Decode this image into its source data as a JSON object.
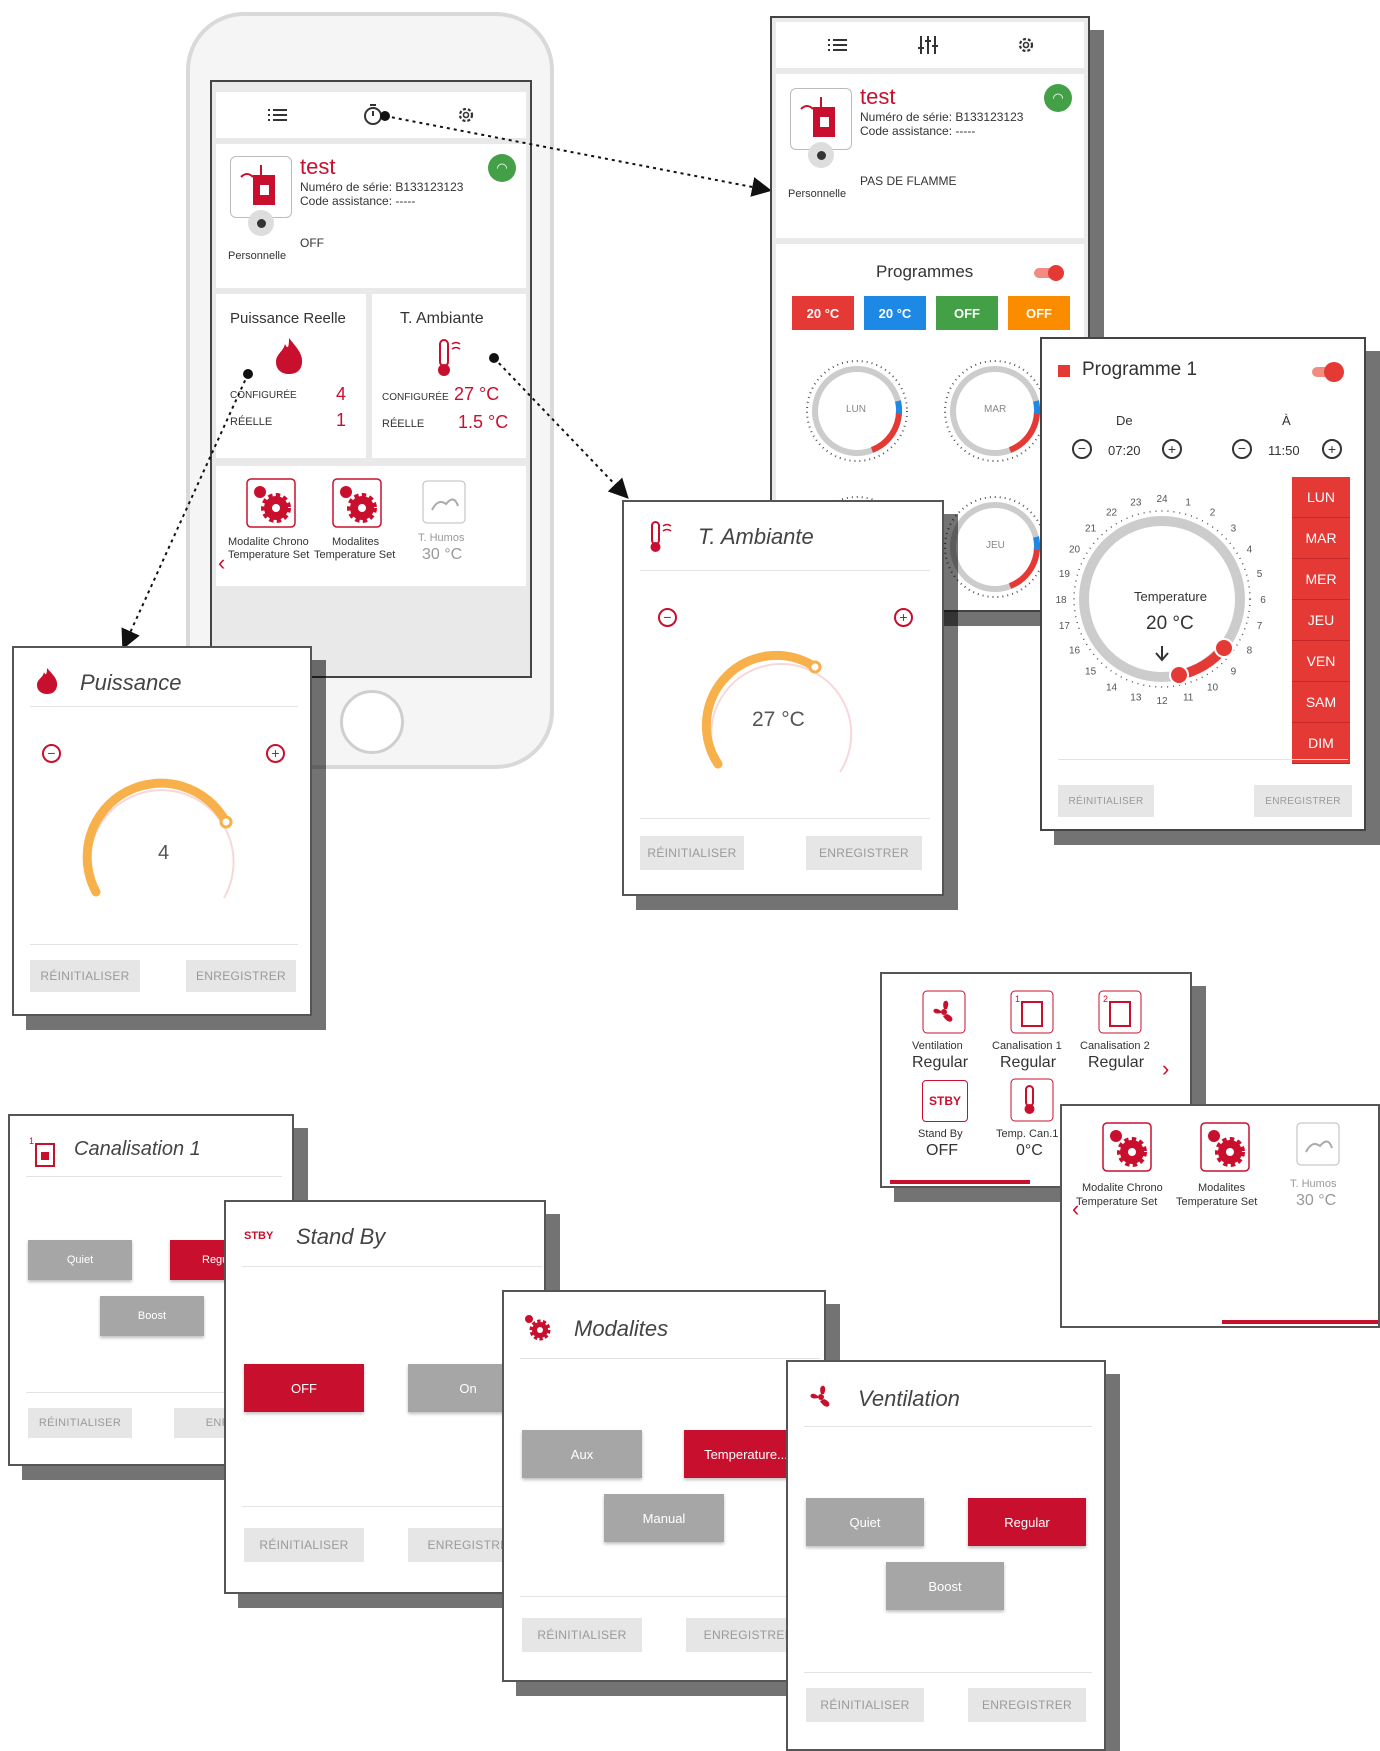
{
  "device": {
    "name": "test",
    "serial": "Numéro de série: B133123123",
    "assist": "Code assistance: -----",
    "user": "Personnelle",
    "state_off": "OFF",
    "state_flame": "PAS DE FLAMME"
  },
  "tiles": {
    "puissance": {
      "title": "Puissance Reelle",
      "conf_label": "CONFIGURÉE",
      "conf_val": "4",
      "reel_label": "RÉELLE",
      "reel_val": "1"
    },
    "ambiante": {
      "title": "T. Ambiante",
      "conf_label": "CONFIGURÉE",
      "conf_val": "27 °C",
      "reel_label": "RÉELLE",
      "reel_val": "1.5 °C"
    },
    "modalite_chrono": {
      "l1": "Modalite Chrono",
      "l2": "Temperature Set"
    },
    "modalites": {
      "l1": "Modalites",
      "l2": "Temperature Set"
    },
    "humos": {
      "l1": "T. Humos",
      "val": "30 °C"
    }
  },
  "programmes": {
    "title": "Programmes",
    "pills": [
      {
        "label": "20 °C",
        "color": "#e53935"
      },
      {
        "label": "20 °C",
        "color": "#1e88e5"
      },
      {
        "label": "OFF",
        "color": "#43a047"
      },
      {
        "label": "OFF",
        "color": "#fb8c00"
      }
    ],
    "days": [
      "LUN",
      "MAR",
      "JEU"
    ]
  },
  "programme1": {
    "title": "Programme 1",
    "de": "De",
    "a": "À",
    "de_time": "07:20",
    "a_time": "11:50",
    "dial_label": "Temperature",
    "dial_value": "20 °C",
    "hours": [
      "24",
      "1",
      "2",
      "3",
      "4",
      "5",
      "6",
      "7",
      "8",
      "9",
      "10",
      "11",
      "12",
      "13",
      "14",
      "15",
      "16",
      "17",
      "18",
      "19",
      "20",
      "21",
      "22",
      "23"
    ],
    "days": [
      "LUN",
      "MAR",
      "MER",
      "JEU",
      "VEN",
      "SAM",
      "DIM"
    ]
  },
  "ambiante_panel": {
    "title": "T. Ambiante",
    "value": "27 °C",
    "level": 0.62
  },
  "puissance_panel": {
    "title": "Puissance",
    "value": "4",
    "level": 0.66
  },
  "buttons": {
    "reset": "RÉINITIALISER",
    "save": "ENREGISTRER",
    "save_cut": "ENREGISTRE",
    "save_cut2": "ENREG",
    "save_cut3": "ENREGISTREI"
  },
  "canalisation1": {
    "title": "Canalisation 1",
    "quiet": "Quiet",
    "regular": "Regu",
    "boost": "Boost"
  },
  "standby": {
    "badge": "STBY",
    "title": "Stand By",
    "off": "OFF",
    "on": "On"
  },
  "modalites_panel": {
    "title": "Modalites",
    "aux": "Aux",
    "temperature": "Temperature...",
    "manual": "Manual"
  },
  "ventilation": {
    "title": "Ventilation",
    "quiet": "Quiet",
    "regular": "Regular",
    "boost": "Boost"
  },
  "grid": {
    "ventilation": {
      "label": "Ventilation",
      "val": "Regular"
    },
    "can1": {
      "label": "Canalisation 1",
      "val": "Regular"
    },
    "can2": {
      "label": "Canalisation 2",
      "val": "Regular"
    },
    "standby": {
      "label": "Stand By",
      "val": "OFF",
      "badge": "STBY"
    },
    "tempcan": {
      "label": "Temp. Can.1",
      "val": "0°C"
    }
  }
}
